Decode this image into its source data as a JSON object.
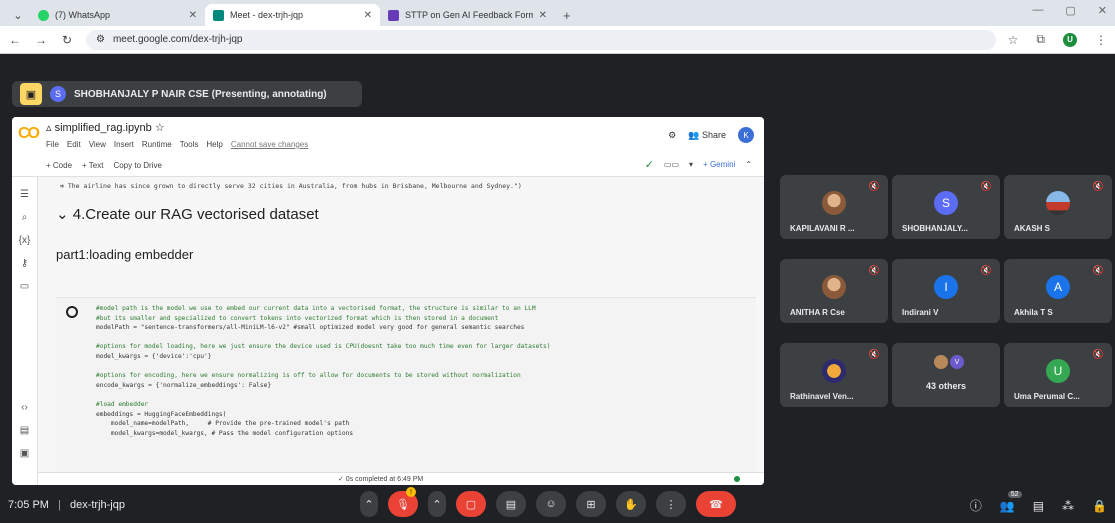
{
  "browser": {
    "tabs": [
      {
        "title": "(7) WhatsApp",
        "color": "#25d366"
      },
      {
        "title": "Meet - dex-trjh-jqp",
        "color": "#00897b"
      },
      {
        "title": "STTP on Gen AI Feedback Form",
        "color": "#673ab7"
      }
    ],
    "url": "meet.google.com/dex-trjh-jqp",
    "profile_initial": "U"
  },
  "meet": {
    "presenter_initial": "S",
    "presenter_label": "SHOBHANJALY P NAIR CSE (Presenting, annotating)",
    "meeting_time": "7:05 PM",
    "separator": "|",
    "meeting_code": "dex-trjh-jqp",
    "participant_count": "52",
    "raise_badge": "!"
  },
  "colab": {
    "logo": "CO",
    "notebook_title": "simplified_rag.ipynb",
    "menu": [
      "File",
      "Edit",
      "View",
      "Insert",
      "Runtime",
      "Tools",
      "Help"
    ],
    "save_notice": "Cannot save changes",
    "share_label": "Share",
    "user_initial": "K",
    "toolbar": [
      "+ Code",
      "+ Text",
      "Copy to Drive"
    ],
    "gemini_label": "+ Gemini",
    "output_text": "The airline has since grown to directly serve 32 cities in Australia, from hubs in Brisbane, Melbourne and Sydney.\")",
    "section_heading": "4.Create our RAG vectorised dataset",
    "sub_heading": "part1:loading embedder",
    "code_lines": [
      "#model path is the model we use to embed our current data into a vectorised format, the structure is similar to an LLM",
      "#but its smaller and specialized to convert tokens into vectorized format which is then stored in a document",
      "modelPath = \"sentence-transformers/all-MiniLM-l6-v2\" #small optimized model very good for general semantic searches",
      "",
      "#options for model loading, here we just ensure the device used is CPU(doesnt take too much time even for larger datasets)",
      "model_kwargs = {'device':'cpu'}",
      "",
      "#options for encoding, here we ensure normalizing is off to allow for documents to be stored without normalization",
      "encode_kwargs = {'normalize_embeddings': False}",
      "",
      "#load embedder",
      "embeddings = HuggingFaceEmbeddings(",
      "    model_name=modelPath,     # Provide the pre-trained model's path",
      "    model_kwargs=model_kwargs, # Pass the model configuration options"
    ],
    "status": "✓ 0s   completed at 6:49 PM"
  },
  "participants": [
    {
      "name": "KAPILAVANI R ...",
      "initial": "",
      "style": "photo"
    },
    {
      "name": "SHOBHANJALY...",
      "initial": "S",
      "color": "#5b6cf5"
    },
    {
      "name": "AKASH S",
      "initial": "",
      "style": "car"
    },
    {
      "name": "ANITHA R Cse",
      "initial": "",
      "style": "photo"
    },
    {
      "name": "Indirani V",
      "initial": "I",
      "color": "#1a73e8"
    },
    {
      "name": "Akhila T S",
      "initial": "A",
      "color": "#1a73e8"
    },
    {
      "name": "Rathinavel Ven...",
      "initial": "",
      "style": "bike"
    },
    {
      "name": "43 others",
      "initial": "V"
    },
    {
      "name": "Uma Perumal C...",
      "initial": "U",
      "color": "#34a853"
    }
  ]
}
